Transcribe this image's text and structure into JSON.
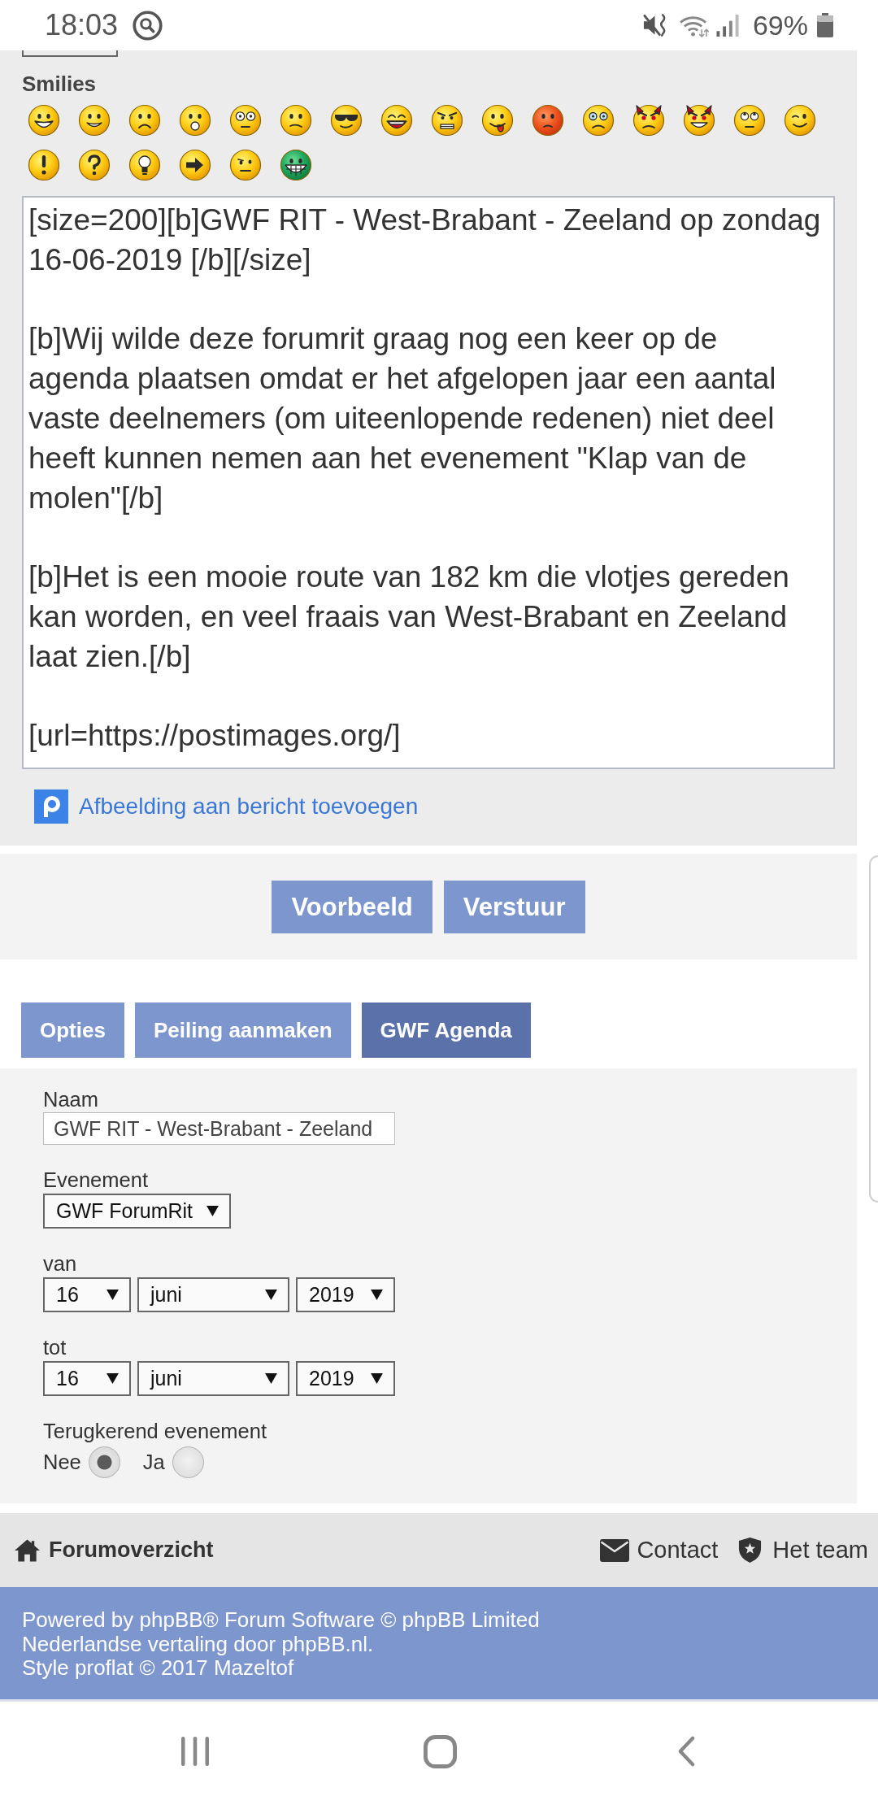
{
  "status_bar": {
    "time": "18:03",
    "battery": "69%"
  },
  "smilies": {
    "label": "Smilies",
    "items": [
      {
        "kind": "grin"
      },
      {
        "kind": "smile"
      },
      {
        "kind": "sad"
      },
      {
        "kind": "surprised"
      },
      {
        "kind": "eek"
      },
      {
        "kind": "confused"
      },
      {
        "kind": "cool"
      },
      {
        "kind": "laugh"
      },
      {
        "kind": "mad"
      },
      {
        "kind": "razz"
      },
      {
        "kind": "embarrassed"
      },
      {
        "kind": "cry"
      },
      {
        "kind": "evil"
      },
      {
        "kind": "twisted"
      },
      {
        "kind": "rolleyes"
      },
      {
        "kind": "wink"
      },
      {
        "kind": "exclaim"
      },
      {
        "kind": "question"
      },
      {
        "kind": "idea"
      },
      {
        "kind": "arrow"
      },
      {
        "kind": "neutral"
      },
      {
        "kind": "mrgreen"
      }
    ]
  },
  "message": {
    "value": "[size=200][b]GWF RIT - West-Brabant - Zeeland op zondag\n16-06-2019 [/b][/size]\n\n[b]Wij wilde deze forumrit graag nog een keer op de\nagenda plaatsen omdat er het afgelopen jaar een aantal\nvaste deelnemers (om uiteenlopende redenen) niet deel\nheeft kunnen nemen aan het evenement \"Klap van de\nmolen\"[/b]\n\n[b]Het is een mooie route van 182 km die vlotjes gereden\nkan worden, en veel fraais van West-Brabant en Zeeland\nlaat zien.[/b]\n\n[url=https://postimages.org/]"
  },
  "upload_link": {
    "label": "Afbeelding aan bericht toevoegen"
  },
  "buttons": [
    {
      "label": "Voorbeeld"
    },
    {
      "label": "Verstuur"
    }
  ],
  "tabs": [
    {
      "label": "Opties",
      "selected": false
    },
    {
      "label": "Peiling aanmaken",
      "selected": false
    },
    {
      "label": "GWF Agenda",
      "selected": true
    }
  ],
  "agenda_form": {
    "name": {
      "label": "Naam",
      "value": "GWF RIT - West-Brabant - Zeeland"
    },
    "event": {
      "label": "Evenement",
      "value": "GWF ForumRit"
    },
    "dates": [
      {
        "label": "van",
        "fields": [
          {
            "kind": "day",
            "value": "16"
          },
          {
            "kind": "month",
            "value": "juni"
          },
          {
            "kind": "year",
            "value": "2019"
          }
        ]
      },
      {
        "label": "tot",
        "fields": [
          {
            "kind": "day",
            "value": "16"
          },
          {
            "kind": "month",
            "value": "juni"
          },
          {
            "kind": "year",
            "value": "2019"
          }
        ]
      }
    ],
    "recurring": {
      "label": "Terugkerend evenement",
      "options": [
        {
          "label": "Nee",
          "selected": true
        },
        {
          "label": "Ja",
          "selected": false
        }
      ]
    }
  },
  "footer_nav": {
    "home": {
      "label": "Forumoverzicht"
    },
    "links": [
      {
        "kind": "mail",
        "label": "Contact"
      },
      {
        "kind": "team",
        "label": "Het team"
      }
    ]
  },
  "footer": {
    "lines": [
      "Powered by phpBB® Forum Software © phpBB Limited",
      "Nederlandse vertaling door phpBB.nl.",
      "Style proflat © 2017 Mazeltof"
    ]
  }
}
